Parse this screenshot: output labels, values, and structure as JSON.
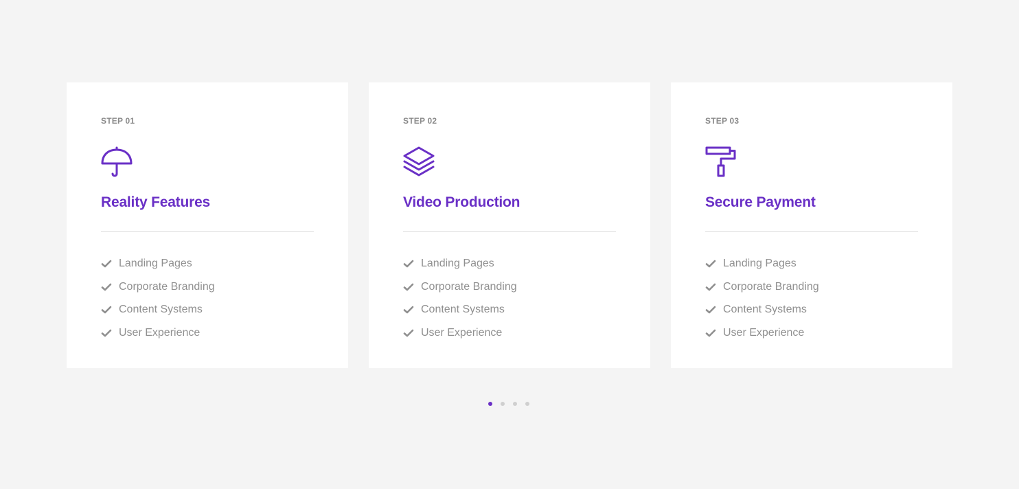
{
  "colors": {
    "accent": "#6a30c6",
    "card_background": "#ffffff",
    "page_background": "#f4f4f4",
    "muted_text": "#909090",
    "divider": "#dedede",
    "inactive_dot": "#cfcfcf"
  },
  "cards": [
    {
      "step": "STEP 01",
      "icon": "umbrella-icon",
      "title": "Reality Features",
      "features": [
        "Landing Pages",
        "Corporate Branding",
        "Content Systems",
        "User Experience"
      ]
    },
    {
      "step": "STEP 02",
      "icon": "layers-icon",
      "title": "Video Production",
      "features": [
        "Landing Pages",
        "Corporate Branding",
        "Content Systems",
        "User Experience"
      ]
    },
    {
      "step": "STEP 03",
      "icon": "paint-roller-icon",
      "title": "Secure Payment",
      "features": [
        "Landing Pages",
        "Corporate Branding",
        "Content Systems",
        "User Experience"
      ]
    }
  ],
  "pagination": {
    "count": 4,
    "active_index": 0
  },
  "feature_icon": "check-icon"
}
